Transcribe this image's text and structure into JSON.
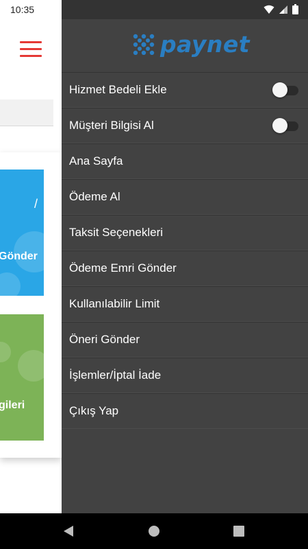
{
  "status_bar": {
    "time": "10:35",
    "icons": [
      "wifi-icon",
      "signal-icon",
      "battery-icon"
    ]
  },
  "background_app": {
    "menu_icon": "hamburger-icon",
    "accent_color": "#e53935",
    "tiles": [
      {
        "label": "Gönder",
        "color": "#2aa6e6"
      },
      {
        "label": "gileri",
        "color": "#7db357"
      }
    ]
  },
  "drawer": {
    "logo_text": "paynet",
    "logo_color": "#2a7ec2",
    "background_color": "#424242",
    "toggle_items": [
      {
        "label": "Hizmet Bedeli Ekle",
        "on": false
      },
      {
        "label": "Müşteri Bilgisi Al",
        "on": false
      }
    ],
    "items": [
      {
        "label": "Ana Sayfa"
      },
      {
        "label": "Ödeme Al"
      },
      {
        "label": "Taksit Seçenekleri"
      },
      {
        "label": "Ödeme Emri Gönder"
      },
      {
        "label": "Kullanılabilir Limit"
      },
      {
        "label": "Öneri Gönder"
      },
      {
        "label": "İşlemler/İptal İade"
      },
      {
        "label": "Çıkış Yap"
      }
    ]
  },
  "nav_bar": {
    "buttons": [
      "back-icon",
      "home-icon",
      "recents-icon"
    ]
  }
}
